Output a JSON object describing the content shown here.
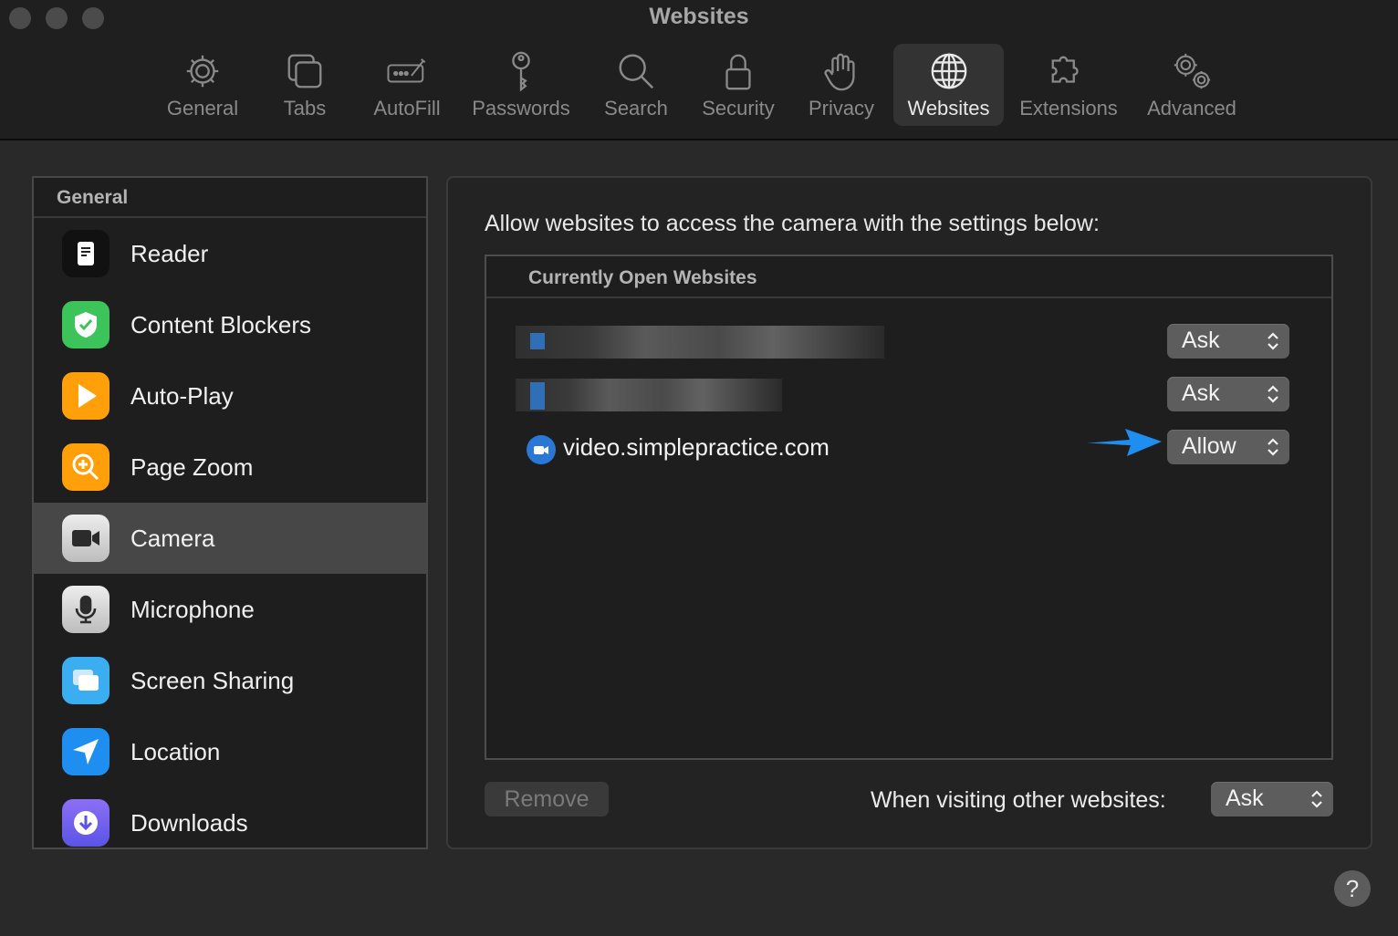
{
  "window": {
    "title": "Websites"
  },
  "toolbar": {
    "items": [
      {
        "label": "General",
        "icon": "gear-icon"
      },
      {
        "label": "Tabs",
        "icon": "tabs-icon"
      },
      {
        "label": "AutoFill",
        "icon": "autofill-icon"
      },
      {
        "label": "Passwords",
        "icon": "key-icon"
      },
      {
        "label": "Search",
        "icon": "search-icon"
      },
      {
        "label": "Security",
        "icon": "lock-icon"
      },
      {
        "label": "Privacy",
        "icon": "hand-icon"
      },
      {
        "label": "Websites",
        "icon": "globe-icon",
        "active": true
      },
      {
        "label": "Extensions",
        "icon": "puzzle-icon"
      },
      {
        "label": "Advanced",
        "icon": "gears-icon"
      }
    ]
  },
  "sidebar": {
    "header": "General",
    "items": [
      {
        "label": "Reader",
        "icon": "reader-icon",
        "color": "#1c1c1c"
      },
      {
        "label": "Content Blockers",
        "icon": "shield-check-icon",
        "color": "#3cc45a"
      },
      {
        "label": "Auto-Play",
        "icon": "play-icon",
        "color": "#ff9f0a"
      },
      {
        "label": "Page Zoom",
        "icon": "zoom-icon",
        "color": "#ff9f0a"
      },
      {
        "label": "Camera",
        "icon": "camera-icon",
        "color": "#d9d9d9",
        "selected": true
      },
      {
        "label": "Microphone",
        "icon": "microphone-icon",
        "color": "#d9d9d9"
      },
      {
        "label": "Screen Sharing",
        "icon": "screen-sharing-icon",
        "color": "#3aaef0"
      },
      {
        "label": "Location",
        "icon": "location-icon",
        "color": "#1e8ef0"
      },
      {
        "label": "Downloads",
        "icon": "download-icon",
        "color": "#7a5cf0"
      }
    ]
  },
  "main": {
    "description": "Allow websites to access the camera with the settings below:",
    "table_header": "Currently Open Websites",
    "sites": [
      {
        "name": "",
        "setting": "Ask",
        "blurred": true
      },
      {
        "name": "",
        "setting": "Ask",
        "blurred": true
      },
      {
        "name": "video.simplepractice.com",
        "setting": "Allow",
        "blurred": false
      }
    ],
    "remove_label": "Remove",
    "other_label": "When visiting other websites:",
    "other_setting": "Ask"
  },
  "help": {
    "label": "?"
  },
  "colors": {
    "annotation_arrow": "#1e8ef0",
    "accent_blue": "#2a78d6"
  }
}
